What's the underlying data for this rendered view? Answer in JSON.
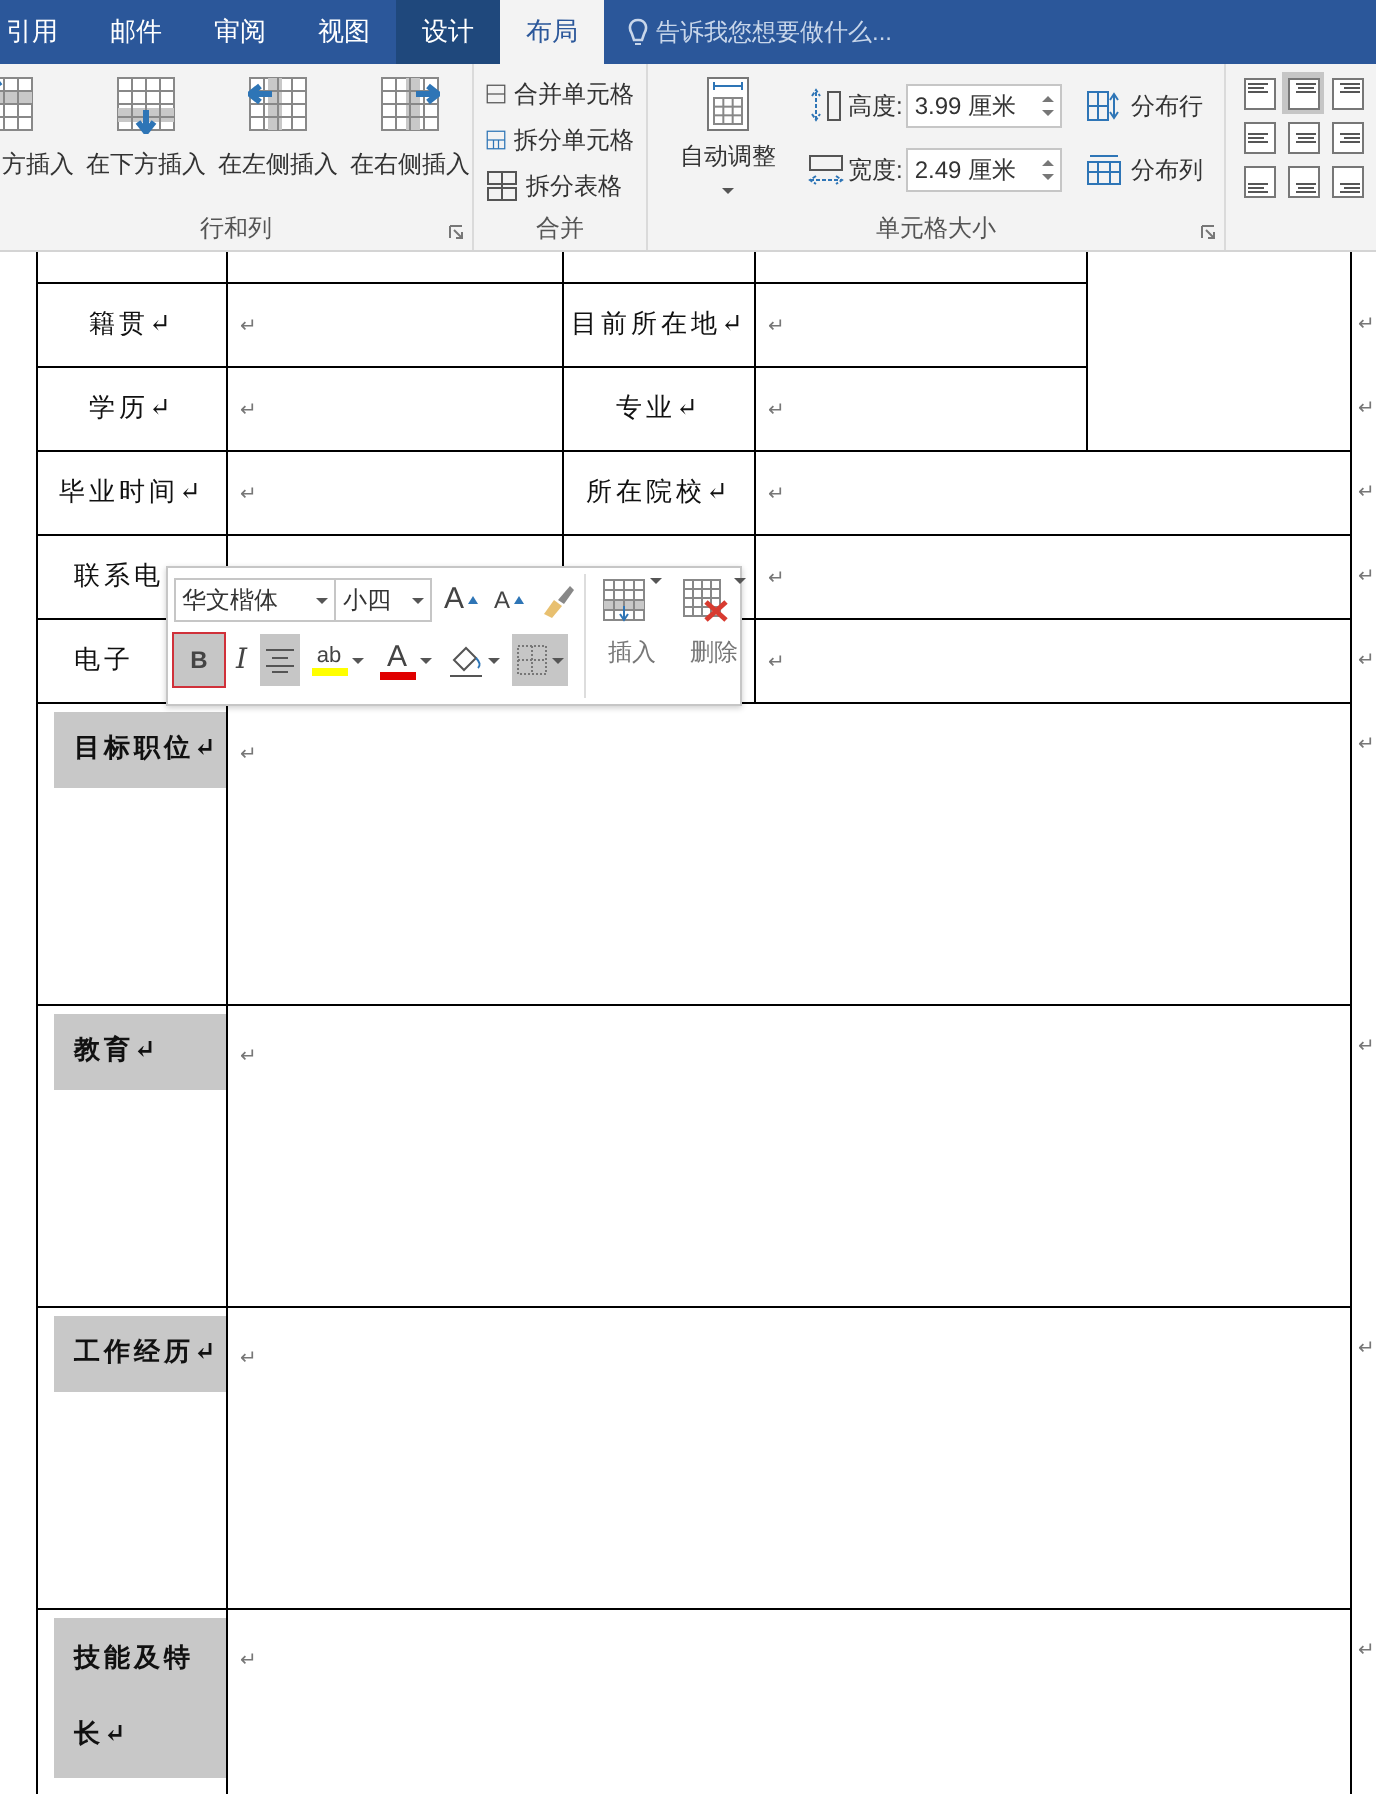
{
  "ribbon_tabs": [
    {
      "label": "引用",
      "selected": false,
      "contextual": false
    },
    {
      "label": "邮件",
      "selected": false,
      "contextual": false
    },
    {
      "label": "审阅",
      "selected": false,
      "contextual": false
    },
    {
      "label": "视图",
      "selected": false,
      "contextual": false
    },
    {
      "label": "设计",
      "selected": false,
      "contextual": true
    },
    {
      "label": "布局",
      "selected": true,
      "contextual": true
    }
  ],
  "tell_me": {
    "placeholder": "告诉我您想要做什么..."
  },
  "groups": [
    {
      "kind": "rows_cols",
      "label": "行和列",
      "buttons": [
        {
          "label": "方插入"
        },
        {
          "label": "在下方插入"
        },
        {
          "label": "在左侧插入"
        },
        {
          "label": "在右侧插入"
        }
      ]
    },
    {
      "kind": "merge",
      "label": "合并",
      "buttons": [
        {
          "label": "合并单元格"
        },
        {
          "label": "拆分单元格"
        },
        {
          "label": "拆分表格"
        }
      ]
    },
    {
      "kind": "cell_size",
      "label": "单元格大小",
      "autofit": "自动调整",
      "height": {
        "label": "高度:",
        "value": "3.99 厘米"
      },
      "width": {
        "label": "宽度:",
        "value": "2.49 厘米"
      },
      "distribute": [
        {
          "label": "分布行"
        },
        {
          "label": "分布列"
        }
      ]
    },
    {
      "kind": "alignment",
      "cells": [
        {
          "selected": false
        },
        {
          "selected": true
        },
        {
          "selected": false
        },
        {
          "selected": false
        },
        {
          "selected": false
        },
        {
          "selected": false
        },
        {
          "selected": false
        },
        {
          "selected": false
        },
        {
          "selected": false
        }
      ]
    }
  ],
  "table": {
    "rows": [
      {
        "kind": "partial"
      },
      {
        "kind": "field",
        "cells": [
          {
            "kind": "label",
            "text": "籍贯↵"
          },
          {
            "kind": "value",
            "text": "↵"
          },
          {
            "kind": "label",
            "text": "目前所在地↵"
          },
          {
            "kind": "value",
            "text": "↵"
          }
        ],
        "end_mark": "↵"
      },
      {
        "kind": "field",
        "cells": [
          {
            "kind": "label",
            "text": "学历↵"
          },
          {
            "kind": "value",
            "text": "↵"
          },
          {
            "kind": "label",
            "text": "专业↵"
          },
          {
            "kind": "value",
            "text": "↵"
          }
        ],
        "end_mark": "↵"
      },
      {
        "kind": "field",
        "cells": [
          {
            "kind": "label",
            "text": "毕业时间↵"
          },
          {
            "kind": "value",
            "text": "↵"
          },
          {
            "kind": "label",
            "text": "所在院校↵"
          },
          {
            "kind": "value",
            "text": "↵"
          }
        ],
        "end_mark": "↵"
      },
      {
        "kind": "field",
        "cells": [
          {
            "kind": "cut_label",
            "text": "联系电"
          },
          {
            "kind": "blank"
          },
          {
            "kind": "blank"
          },
          {
            "kind": "value",
            "text": "↵"
          }
        ],
        "end_mark": "↵"
      },
      {
        "kind": "field",
        "cells": [
          {
            "kind": "cut_label",
            "text": "电子"
          },
          {
            "kind": "blank"
          },
          {
            "kind": "blank"
          },
          {
            "kind": "value",
            "text": "↵"
          }
        ],
        "end_mark": "↵"
      },
      {
        "kind": "section",
        "label": "目标职位↵",
        "content": "↵",
        "end_mark": "↵"
      },
      {
        "kind": "section",
        "label": "教育↵",
        "content": "↵",
        "end_mark": "↵"
      },
      {
        "kind": "section",
        "label": "工作经历↵",
        "content": "↵",
        "end_mark": "↵"
      },
      {
        "kind": "section",
        "label": "技能及特长↵",
        "content": "↵",
        "end_mark": "↵"
      }
    ]
  },
  "mini_toolbar": {
    "font": "华文楷体",
    "size": "小四",
    "tools": [
      {
        "kind": "grow",
        "glyph": "A"
      },
      {
        "kind": "shrink",
        "glyph": "A"
      },
      {
        "kind": "painter"
      }
    ],
    "format": [
      {
        "kind": "bold",
        "glyph": "B",
        "selected": true,
        "outlined": true
      },
      {
        "kind": "italic",
        "glyph": "I",
        "selected": false,
        "outlined": false
      },
      {
        "kind": "center",
        "selected": true,
        "outlined": false
      },
      {
        "kind": "highlight",
        "glyph": "ab",
        "color": "#ffff00",
        "selected": false,
        "outlined": false
      },
      {
        "kind": "font_color",
        "glyph": "A",
        "color": "#e00000",
        "selected": false,
        "outlined": false
      },
      {
        "kind": "shading",
        "selected": false,
        "outlined": false
      },
      {
        "kind": "borders",
        "selected": true,
        "outlined": false
      }
    ],
    "table_actions": [
      {
        "kind": "insert",
        "label": "插入"
      },
      {
        "kind": "delete",
        "label": "删除"
      }
    ]
  }
}
